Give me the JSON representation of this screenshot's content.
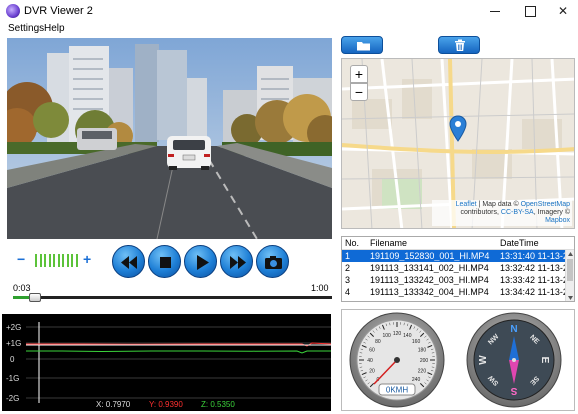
{
  "window": {
    "title": "DVR Viewer 2"
  },
  "menu": {
    "items": [
      "Settings",
      "Help"
    ]
  },
  "map": {
    "zoom_in": "+",
    "zoom_out": "−",
    "attribution": {
      "leaflet": "Leaflet",
      "prefix": " | Map data © ",
      "osm": "OpenStreetMap",
      "contributors": " contributors, ",
      "license": "CC-BY-SA",
      "imagery": ", Imagery © ",
      "provider": "Mapbox"
    }
  },
  "toolbar": {
    "open_icon": "folder-icon",
    "delete_icon": "trash-icon"
  },
  "volume": {
    "minus": "−",
    "plus": "+",
    "level_bars": 10
  },
  "controls": {
    "prev_icon": "skip-back-icon",
    "stop_icon": "stop-icon",
    "play_icon": "play-icon",
    "next_icon": "skip-forward-icon",
    "snapshot_icon": "camera-icon"
  },
  "playback": {
    "current_time": "0:03",
    "total_time": "1:00",
    "progress": 0.05
  },
  "graph": {
    "y_labels": [
      "+2G",
      "+1G",
      "0",
      "-1G",
      "-2G"
    ],
    "readout": {
      "x": "X: 0.7970",
      "y": "Y: 0.9390",
      "z": "Z: 0.5350"
    },
    "colors": {
      "x": "#ffffff",
      "y": "#ff3030",
      "z": "#3bd33b"
    }
  },
  "files": {
    "headers": {
      "no": "No.",
      "filename": "Filename",
      "datetime": "DateTime"
    },
    "rows": [
      {
        "no": "1",
        "filename": "191109_152830_001_HI.MP4",
        "datetime": "13:31:40 11-13-2"
      },
      {
        "no": "2",
        "filename": "191113_133141_002_HI.MP4",
        "datetime": "13:32:42 11-13-2"
      },
      {
        "no": "3",
        "filename": "191113_133242_003_HI.MP4",
        "datetime": "13:33:42 11-13-2"
      },
      {
        "no": "4",
        "filename": "191113_133342_004_HI.MP4",
        "datetime": "13:34:42 11-13-2"
      }
    ],
    "selected_index": 0
  },
  "speedometer": {
    "speed_label": "0KMH",
    "speed": 0,
    "ticks": [
      "0",
      "20",
      "40",
      "60",
      "80",
      "100",
      "120",
      "140",
      "160",
      "180",
      "200",
      "220",
      "240"
    ]
  },
  "compass": {
    "labels": [
      "N",
      "NE",
      "E",
      "SE",
      "S",
      "SW",
      "W",
      "NW"
    ]
  }
}
